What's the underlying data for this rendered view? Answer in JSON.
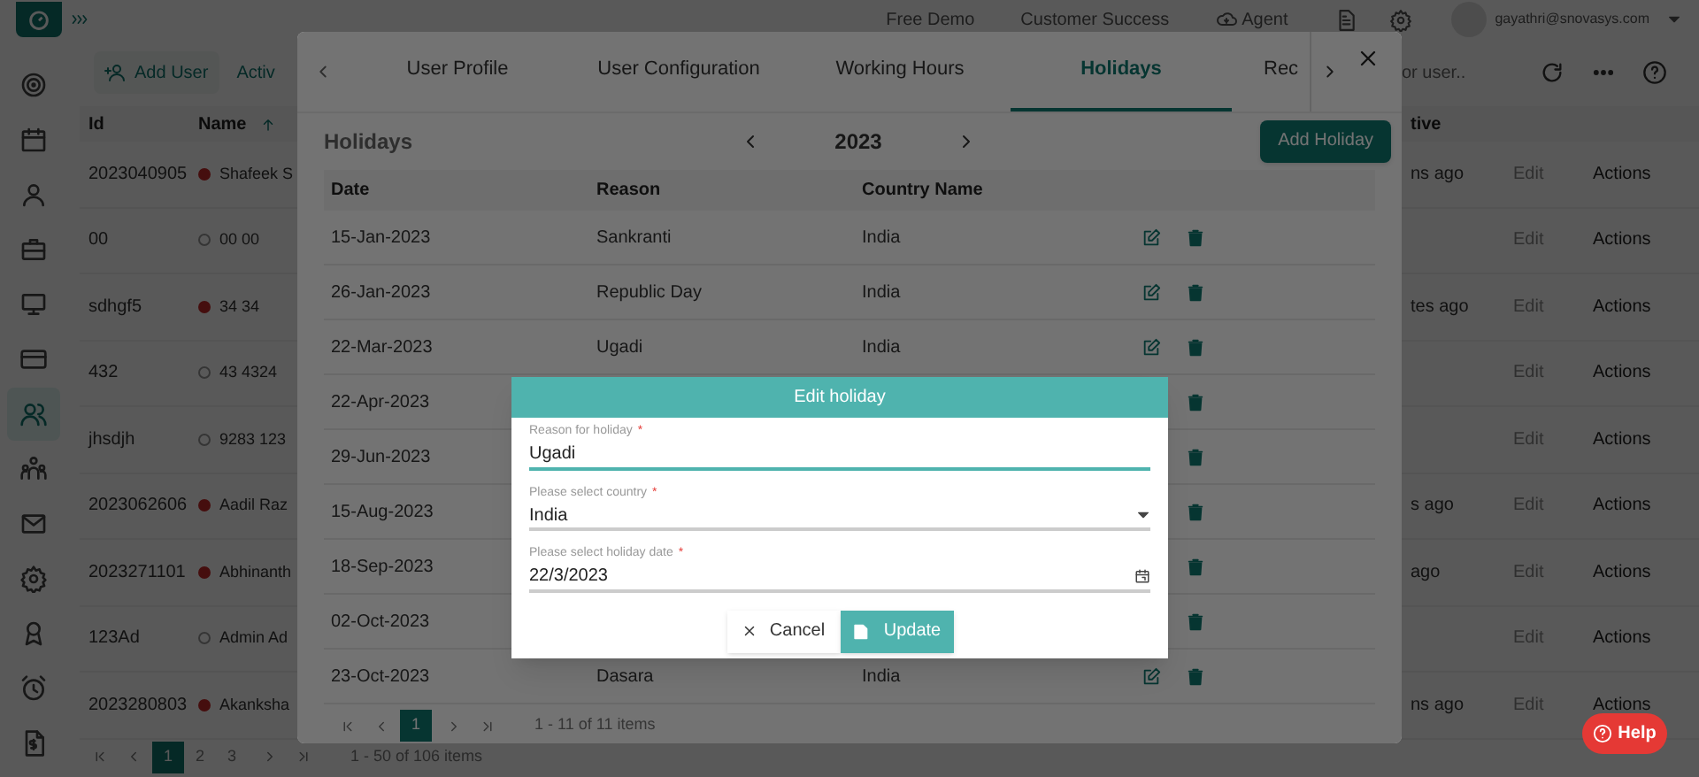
{
  "top_bar": {
    "links": [
      {
        "label": "Free Demo",
        "kind": "plain"
      },
      {
        "label": "Customer Success",
        "kind": "plain"
      },
      {
        "label": "Agent",
        "kind": "cloud"
      }
    ],
    "user_email": "gayathri@snovasys.com"
  },
  "sidebar": {
    "items": [
      {
        "selected": false
      },
      {
        "selected": false
      },
      {
        "selected": false
      },
      {
        "selected": false
      },
      {
        "selected": false
      },
      {
        "selected": false
      },
      {
        "selected": true
      },
      {
        "selected": false
      },
      {
        "selected": false
      },
      {
        "selected": false
      },
      {
        "selected": false
      },
      {
        "selected": false
      },
      {
        "selected": false
      }
    ]
  },
  "toolbar": {
    "add_user": "Add User",
    "filter_tab": "Activ",
    "search_placeholder": "or user.."
  },
  "users_table": {
    "columns": [
      "Id",
      "Name",
      "tive"
    ],
    "rows": [
      {
        "id": "2023040905",
        "online": true,
        "name": "Shafeek S",
        "last_active": "ns ago",
        "edit": "Edit",
        "actions": "Actions"
      },
      {
        "id": "00",
        "online": false,
        "name": "00 00",
        "last_active": "",
        "edit": "Edit",
        "actions": "Actions"
      },
      {
        "id": "sdhgf5",
        "online": true,
        "name": "34 34",
        "last_active": "tes ago",
        "edit": "Edit",
        "actions": "Actions"
      },
      {
        "id": "432",
        "online": false,
        "name": "43 4324",
        "last_active": "",
        "edit": "Edit",
        "actions": "Actions"
      },
      {
        "id": "jhsdjh",
        "online": false,
        "name": "9283 123",
        "last_active": "",
        "edit": "Edit",
        "actions": "Actions"
      },
      {
        "id": "2023062606",
        "online": true,
        "name": "Aadil Raz",
        "last_active": "s ago",
        "edit": "Edit",
        "actions": "Actions"
      },
      {
        "id": "2023271101",
        "online": true,
        "name": "Abhinanth",
        "last_active": "ago",
        "edit": "Edit",
        "actions": "Actions"
      },
      {
        "id": "123Ad",
        "online": false,
        "name": "Admin Ad",
        "last_active": "",
        "edit": "Edit",
        "actions": "Actions"
      },
      {
        "id": "2023280803",
        "online": true,
        "name": "Akanksha",
        "last_active": "ns ago",
        "edit": "Edit",
        "actions": "Actions"
      }
    ]
  },
  "pager": {
    "pages": [
      {
        "label": "1",
        "selected": true
      },
      {
        "label": "2",
        "selected": false
      },
      {
        "label": "3",
        "selected": false
      }
    ],
    "summary": "1 - 50 of 106 items"
  },
  "help_button": "Help",
  "modal": {
    "tabs": [
      {
        "label": "User Profile",
        "selected": false
      },
      {
        "label": "User Configuration",
        "selected": false
      },
      {
        "label": "Working Hours",
        "selected": false
      },
      {
        "label": "Holidays",
        "selected": true
      },
      {
        "label": "Rec",
        "selected": false
      }
    ],
    "title": "Holidays",
    "year": "2023",
    "add_button": "Add Holiday",
    "columns": [
      "Date",
      "Reason",
      "Country Name"
    ],
    "rows": [
      {
        "date": "15-Jan-2023",
        "reason": "Sankranti",
        "country": "India"
      },
      {
        "date": "26-Jan-2023",
        "reason": "Republic Day",
        "country": "India"
      },
      {
        "date": "22-Mar-2023",
        "reason": "Ugadi",
        "country": "India"
      },
      {
        "date": "22-Apr-2023",
        "reason": "",
        "country": ""
      },
      {
        "date": "29-Jun-2023",
        "reason": "",
        "country": ""
      },
      {
        "date": "15-Aug-2023",
        "reason": "",
        "country": ""
      },
      {
        "date": "18-Sep-2023",
        "reason": "",
        "country": ""
      },
      {
        "date": "02-Oct-2023",
        "reason": "",
        "country": ""
      },
      {
        "date": "23-Oct-2023",
        "reason": "Dasara",
        "country": "India"
      }
    ],
    "pager": {
      "pages": [
        {
          "label": "1",
          "selected": true
        }
      ],
      "summary": "1 - 11 of 11 items"
    }
  },
  "dialog": {
    "title": "Edit holiday",
    "fields": [
      {
        "kind": "text",
        "label": "Reason for holiday",
        "required_mark": "*",
        "value": "Ugadi",
        "focused": true
      },
      {
        "kind": "select",
        "label": "Please select country",
        "required_mark": "*",
        "value": "India",
        "focused": false
      },
      {
        "kind": "date",
        "label": "Please select holiday date",
        "required_mark": "*",
        "value": "22/3/2023",
        "focused": false
      }
    ],
    "buttons": [
      {
        "kind": "cancel",
        "label": "Cancel"
      },
      {
        "kind": "primary",
        "label": "Update"
      }
    ]
  }
}
